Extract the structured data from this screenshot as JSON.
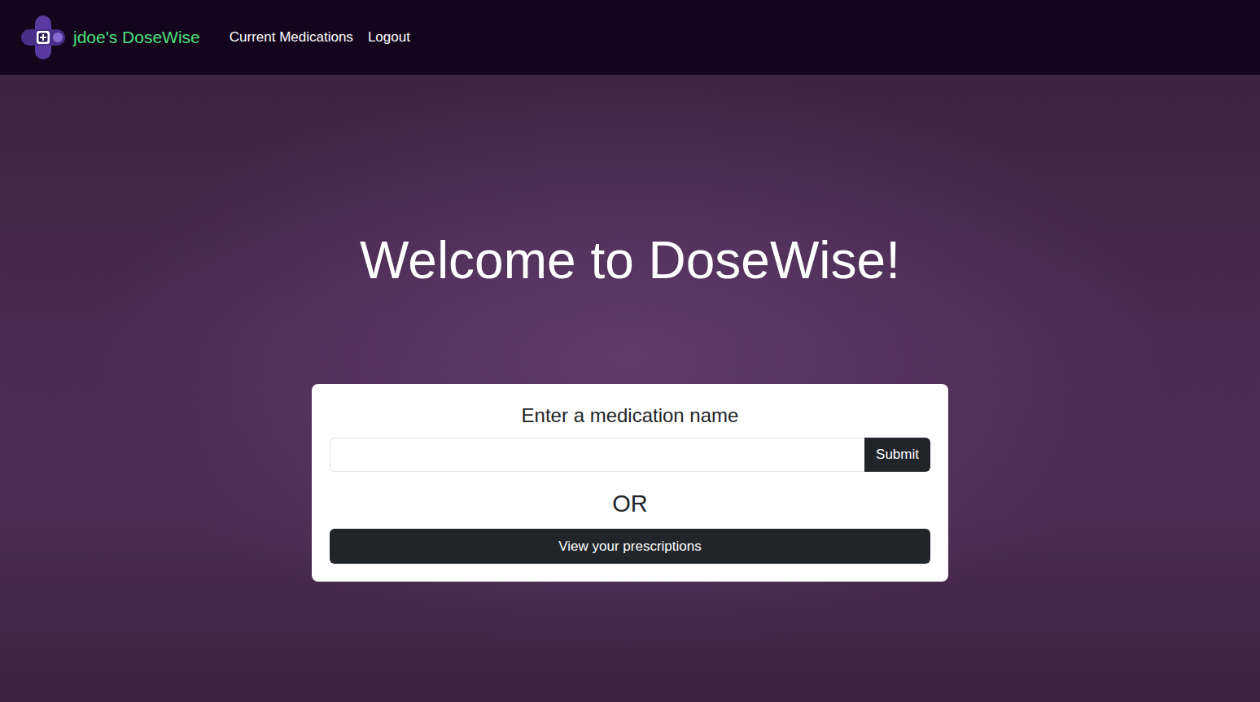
{
  "nav": {
    "brand": "jdoe's DoseWise",
    "links": [
      "Current Medications",
      "Logout"
    ]
  },
  "hero": {
    "title": "Welcome to DoseWise!"
  },
  "form": {
    "label": "Enter a medication name",
    "value": "",
    "submit": "Submit",
    "separator": "OR",
    "prescriptions_button": "View your prescriptions"
  }
}
